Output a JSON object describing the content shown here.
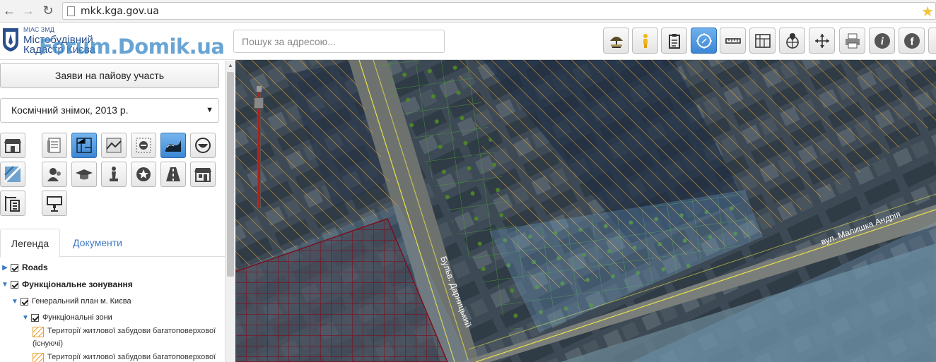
{
  "browser": {
    "url": "mkk.kga.gov.ua",
    "icons": [
      "back-arrow-icon",
      "forward-arrow-icon",
      "reload-icon",
      "page-icon",
      "bookmark-star-icon"
    ]
  },
  "header": {
    "logo_small": "МІАС ЗМД",
    "logo_line1": "Містобудівний",
    "logo_line2": "Кадастр Києва",
    "watermark": "Forum.Domik.ua",
    "search_placeholder": "Пошук за адресою...",
    "tools": [
      {
        "icon": "umbrella-icon",
        "active": false
      },
      {
        "icon": "person-icon",
        "active": false
      },
      {
        "icon": "clipboard-icon",
        "active": false
      },
      {
        "icon": "compass-icon",
        "active": true
      },
      {
        "icon": "ruler-icon",
        "active": false
      },
      {
        "icon": "plan-icon",
        "active": false
      },
      {
        "icon": "globe-pin-icon",
        "active": false
      },
      {
        "icon": "pan-arrows-icon",
        "active": false
      },
      {
        "icon": "printer-icon",
        "active": false
      },
      {
        "icon": "info-icon",
        "active": false
      },
      {
        "icon": "facebook-icon",
        "active": false
      }
    ]
  },
  "sidebar": {
    "pai_button": "Заяви на пайову участь",
    "basemap_selected": "Космічний знімок, 2013 р.",
    "tabs": {
      "legend": "Легенда",
      "documents": "Документи"
    },
    "tree": {
      "roads": "Roads",
      "zoning": "Функціональне зонування",
      "genplan": "Генеральний план м. Києва",
      "zones": "Функціональні зони",
      "item1_line1": "Території житлової забудови багатоповерхової",
      "item1_line2": "(існуючі)",
      "item2_line1": "Території житлової забудови багатоповерхової"
    }
  },
  "map": {
    "street1": "вул. Малишка Андрія",
    "street2": "Бульв. Дарницький"
  },
  "colors": {
    "accent_blue": "#3c86d6",
    "zoning_orange": "#f0a030",
    "grid_green": "#4fa040",
    "red_grid": "#8a1420"
  }
}
